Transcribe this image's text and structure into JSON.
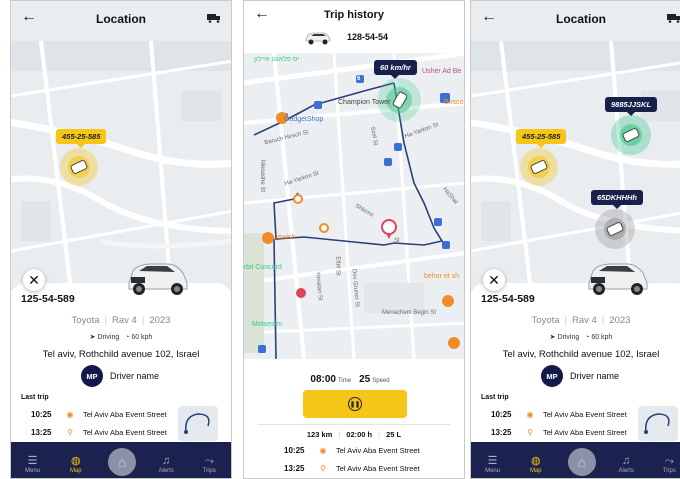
{
  "colors": {
    "accent": "#f5c518",
    "navy": "#1b2250",
    "route": "#2a3f7a",
    "green": "#3cc58a",
    "orange": "#f08c27",
    "red": "#e0405a"
  },
  "location_screen_left": {
    "title": "Location",
    "marker_label": "455-25-585",
    "plate": "125-54-589",
    "make": "Toyota",
    "model": "Rav 4",
    "year": "2023",
    "mode": "Driving",
    "speed": "60 kph",
    "address": "Tel aviv, Rothchild avenue 102, Israel",
    "driver_initials": "MP",
    "driver_name": "Driver name",
    "last_trip_label": "Last trip",
    "trips": [
      {
        "time": "10:25",
        "name": "Tel Aviv Aba Event Street"
      },
      {
        "time": "13:25",
        "name": "Tel Aviv Aba Event Street"
      }
    ],
    "nav": [
      {
        "label": "Menu",
        "icon": "menu-icon"
      },
      {
        "label": "Map",
        "icon": "globe-icon"
      },
      {
        "label": "Alerts",
        "icon": "bell-icon"
      },
      {
        "label": "Trips",
        "icon": "route-icon"
      }
    ]
  },
  "trip_history_screen": {
    "title": "Trip history",
    "plate": "128-54-54",
    "speed_tag": "60 km/hr",
    "map_labels": {
      "hebrew_poi": "יס פלאנט איילון",
      "gadget": "GadgetShop",
      "champion": "Champion Tower",
      "bosco": "Bosco",
      "usher": "Usher Ad Be",
      "jewish": "Jewish",
      "ideal": "dal Concord",
      "behor": "behor et sh",
      "motsesim": "Motsesim",
      "menachem": "Menachem Begin St",
      "baruch": "Baruch Hirsch St",
      "hayarkon1": "Ha-Yarkon St",
      "hayarkon2": "Ha-Yarkon St",
      "shlomo": "Shlomo",
      "menashe": "Menashe St",
      "ettel": "Ettel St",
      "yonatan": "Yonatan St",
      "dov": "Dov Gruner St",
      "hashal": "HaShal",
      "haim": "Haim St",
      "haezer": "Haezer St",
      "szel": "Szel St",
      "street_st": "St",
      "elev": "6"
    },
    "time_value": "08:00",
    "time_label": "Time",
    "speed_value": "25",
    "speed_label": "Speed",
    "distance": "123 km",
    "duration": "02:00 h",
    "fuel": "25 L",
    "trips": [
      {
        "time": "10:25",
        "name": "Tel Aviv Aba Event Street"
      },
      {
        "time": "13:25",
        "name": "Tel Aviv Aba Event Street"
      }
    ]
  },
  "location_screen_right": {
    "title": "Location",
    "markers": [
      "455-25-585",
      "9885JJSKL",
      "65DKHHHh"
    ],
    "plate": "125-54-589",
    "make": "Toyota",
    "model": "Rav 4",
    "year": "2023",
    "mode": "Driving",
    "speed": "60 kph",
    "address": "Tel aviv, Rothchild avenue 102, Israel",
    "driver_initials": "MP",
    "driver_name": "Driver name",
    "last_trip_label": "Last trip",
    "trips": [
      {
        "time": "10:25",
        "name": "Tel Aviv Aba Event Street"
      },
      {
        "time": "13:25",
        "name": "Tel Aviv Aba Event Street"
      }
    ],
    "nav": [
      {
        "label": "Menu",
        "icon": "menu-icon"
      },
      {
        "label": "Map",
        "icon": "globe-icon"
      },
      {
        "label": "Alerts",
        "icon": "bell-icon"
      },
      {
        "label": "Trips",
        "icon": "route-icon"
      }
    ]
  }
}
